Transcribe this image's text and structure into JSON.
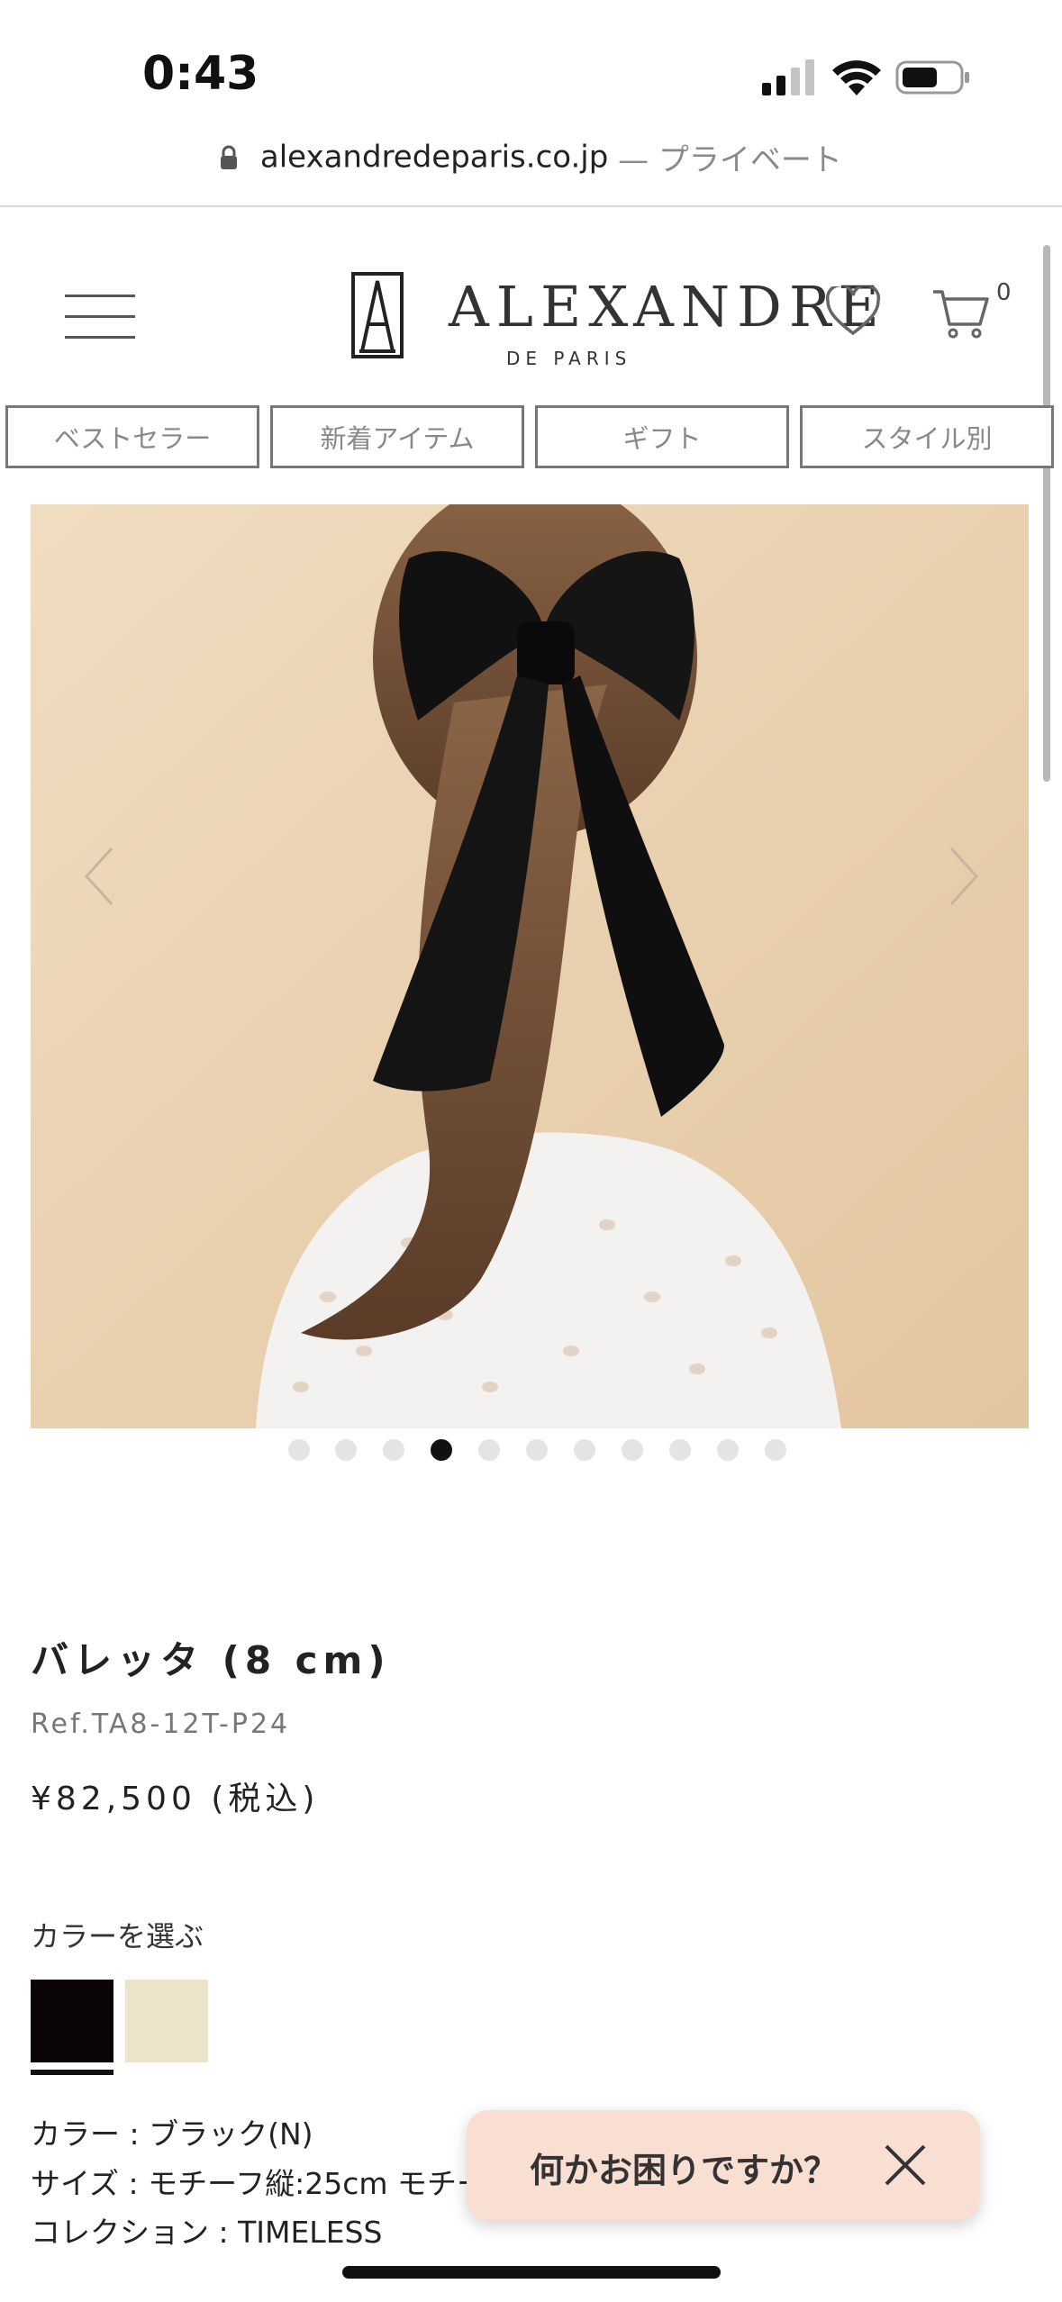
{
  "status_bar": {
    "time": "0:43"
  },
  "browser": {
    "domain": "alexandredeparis.co.jp",
    "privacy_label": "— プライベート"
  },
  "header": {
    "logo_main": "ALEXANDRE",
    "logo_sub": "DE PARIS",
    "cart_count": "0",
    "icons": [
      "menu-icon",
      "heart-icon",
      "cart-icon"
    ]
  },
  "nav": {
    "tabs": [
      {
        "label": "ベストセラー"
      },
      {
        "label": "新着アイテム"
      },
      {
        "label": "ギフト"
      },
      {
        "label": "スタイル別"
      }
    ]
  },
  "gallery": {
    "total_images": 11,
    "active_index": 4
  },
  "product": {
    "title": "バレッタ (8 cm)",
    "ref": "Ref.TA8-12T-P24",
    "price": "¥82,500 (税込)",
    "color_heading": "カラーを選ぶ",
    "swatches": [
      {
        "color": "#0b0506",
        "selected": true
      },
      {
        "color": "#ece3cb",
        "selected": false
      }
    ],
    "details": [
      "カラー : ブラック(N)",
      "サイズ : モチーフ縦:25cm モチーフ",
      "コレクション : TIMELESS"
    ]
  },
  "chat": {
    "label": "何かお困りですか？"
  },
  "colors": {
    "accent_dark": "#111111",
    "chat_bg": "#f9dfd2",
    "photo_bg": "#ecd7b8"
  }
}
